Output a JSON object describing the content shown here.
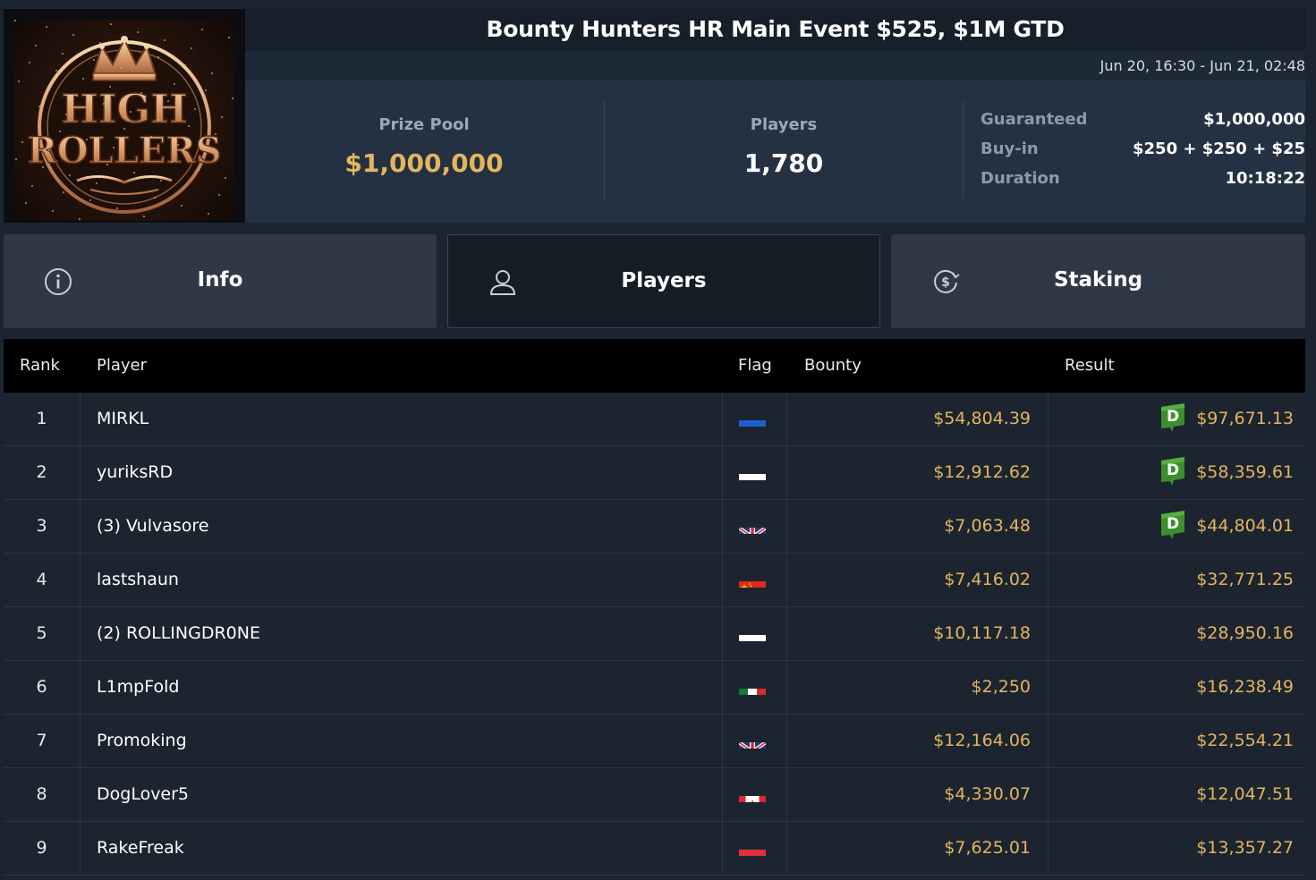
{
  "logo": {
    "line1": "HIGH",
    "line2": "ROLLERS"
  },
  "tournament": {
    "title": "Bounty Hunters HR Main Event $525, $1M GTD",
    "dates": "Jun 20, 16:30 - Jun 21, 02:48"
  },
  "stats": {
    "prize_pool_label": "Prize Pool",
    "prize_pool_value": "$1,000,000",
    "players_label": "Players",
    "players_value": "1,780",
    "guaranteed_label": "Guaranteed",
    "guaranteed_value": "$1,000,000",
    "buyin_label": "Buy-in",
    "buyin_value": "$250 + $250 + $25",
    "duration_label": "Duration",
    "duration_value": "10:18:22"
  },
  "tabs": [
    {
      "label": "Info",
      "icon": "info-icon"
    },
    {
      "label": "Players",
      "icon": "user-icon",
      "active": true
    },
    {
      "label": "Staking",
      "icon": "dollar-cycle-icon"
    }
  ],
  "table": {
    "headers": {
      "rank": "Rank",
      "player": "Player",
      "flag": "Flag",
      "bounty": "Bounty",
      "result": "Result"
    },
    "rows": [
      {
        "rank": "1",
        "player": "MIRKL",
        "flag": "ua",
        "bounty": "$54,804.39",
        "result": "$97,671.13",
        "badge": true
      },
      {
        "rank": "2",
        "player": "yuriksRD",
        "flag": "ru",
        "bounty": "$12,912.62",
        "result": "$58,359.61",
        "badge": true
      },
      {
        "rank": "3",
        "player": "(3) Vulvasore",
        "flag": "gb",
        "bounty": "$7,063.48",
        "result": "$44,804.01",
        "badge": true
      },
      {
        "rank": "4",
        "player": "lastshaun",
        "flag": "cn",
        "bounty": "$7,416.02",
        "result": "$32,771.25",
        "badge": false
      },
      {
        "rank": "5",
        "player": "(2) ROLLINGDR0NE",
        "flag": "pl",
        "bounty": "$10,117.18",
        "result": "$28,950.16",
        "badge": false
      },
      {
        "rank": "6",
        "player": "L1mpFold",
        "flag": "mx",
        "bounty": "$2,250",
        "result": "$16,238.49",
        "badge": false
      },
      {
        "rank": "7",
        "player": "Promoking",
        "flag": "gb",
        "bounty": "$12,164.06",
        "result": "$22,554.21",
        "badge": false
      },
      {
        "rank": "8",
        "player": "DogLover5",
        "flag": "ca",
        "bounty": "$4,330.07",
        "result": "$12,047.51",
        "badge": false
      },
      {
        "rank": "9",
        "player": "RakeFreak",
        "flag": "at",
        "bounty": "$7,625.01",
        "result": "$13,357.27",
        "badge": false
      }
    ]
  },
  "colors": {
    "gold": "#e3b55d",
    "badge_green": "#3e8e2e"
  }
}
